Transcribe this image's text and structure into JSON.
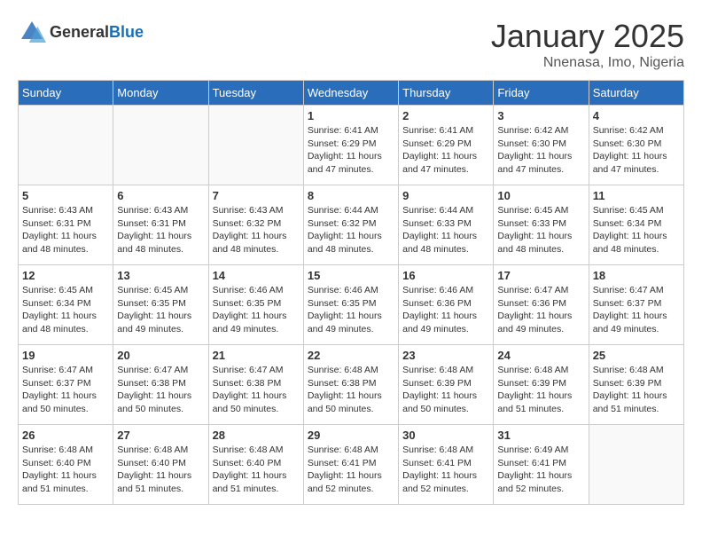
{
  "header": {
    "logo_general": "General",
    "logo_blue": "Blue",
    "month_title": "January 2025",
    "location": "Nnenasa, Imo, Nigeria"
  },
  "days_of_week": [
    "Sunday",
    "Monday",
    "Tuesday",
    "Wednesday",
    "Thursday",
    "Friday",
    "Saturday"
  ],
  "weeks": [
    [
      {
        "day": "",
        "info": ""
      },
      {
        "day": "",
        "info": ""
      },
      {
        "day": "",
        "info": ""
      },
      {
        "day": "1",
        "info": "Sunrise: 6:41 AM\nSunset: 6:29 PM\nDaylight: 11 hours and 47 minutes."
      },
      {
        "day": "2",
        "info": "Sunrise: 6:41 AM\nSunset: 6:29 PM\nDaylight: 11 hours and 47 minutes."
      },
      {
        "day": "3",
        "info": "Sunrise: 6:42 AM\nSunset: 6:30 PM\nDaylight: 11 hours and 47 minutes."
      },
      {
        "day": "4",
        "info": "Sunrise: 6:42 AM\nSunset: 6:30 PM\nDaylight: 11 hours and 47 minutes."
      }
    ],
    [
      {
        "day": "5",
        "info": "Sunrise: 6:43 AM\nSunset: 6:31 PM\nDaylight: 11 hours and 48 minutes."
      },
      {
        "day": "6",
        "info": "Sunrise: 6:43 AM\nSunset: 6:31 PM\nDaylight: 11 hours and 48 minutes."
      },
      {
        "day": "7",
        "info": "Sunrise: 6:43 AM\nSunset: 6:32 PM\nDaylight: 11 hours and 48 minutes."
      },
      {
        "day": "8",
        "info": "Sunrise: 6:44 AM\nSunset: 6:32 PM\nDaylight: 11 hours and 48 minutes."
      },
      {
        "day": "9",
        "info": "Sunrise: 6:44 AM\nSunset: 6:33 PM\nDaylight: 11 hours and 48 minutes."
      },
      {
        "day": "10",
        "info": "Sunrise: 6:45 AM\nSunset: 6:33 PM\nDaylight: 11 hours and 48 minutes."
      },
      {
        "day": "11",
        "info": "Sunrise: 6:45 AM\nSunset: 6:34 PM\nDaylight: 11 hours and 48 minutes."
      }
    ],
    [
      {
        "day": "12",
        "info": "Sunrise: 6:45 AM\nSunset: 6:34 PM\nDaylight: 11 hours and 48 minutes."
      },
      {
        "day": "13",
        "info": "Sunrise: 6:45 AM\nSunset: 6:35 PM\nDaylight: 11 hours and 49 minutes."
      },
      {
        "day": "14",
        "info": "Sunrise: 6:46 AM\nSunset: 6:35 PM\nDaylight: 11 hours and 49 minutes."
      },
      {
        "day": "15",
        "info": "Sunrise: 6:46 AM\nSunset: 6:35 PM\nDaylight: 11 hours and 49 minutes."
      },
      {
        "day": "16",
        "info": "Sunrise: 6:46 AM\nSunset: 6:36 PM\nDaylight: 11 hours and 49 minutes."
      },
      {
        "day": "17",
        "info": "Sunrise: 6:47 AM\nSunset: 6:36 PM\nDaylight: 11 hours and 49 minutes."
      },
      {
        "day": "18",
        "info": "Sunrise: 6:47 AM\nSunset: 6:37 PM\nDaylight: 11 hours and 49 minutes."
      }
    ],
    [
      {
        "day": "19",
        "info": "Sunrise: 6:47 AM\nSunset: 6:37 PM\nDaylight: 11 hours and 50 minutes."
      },
      {
        "day": "20",
        "info": "Sunrise: 6:47 AM\nSunset: 6:38 PM\nDaylight: 11 hours and 50 minutes."
      },
      {
        "day": "21",
        "info": "Sunrise: 6:47 AM\nSunset: 6:38 PM\nDaylight: 11 hours and 50 minutes."
      },
      {
        "day": "22",
        "info": "Sunrise: 6:48 AM\nSunset: 6:38 PM\nDaylight: 11 hours and 50 minutes."
      },
      {
        "day": "23",
        "info": "Sunrise: 6:48 AM\nSunset: 6:39 PM\nDaylight: 11 hours and 50 minutes."
      },
      {
        "day": "24",
        "info": "Sunrise: 6:48 AM\nSunset: 6:39 PM\nDaylight: 11 hours and 51 minutes."
      },
      {
        "day": "25",
        "info": "Sunrise: 6:48 AM\nSunset: 6:39 PM\nDaylight: 11 hours and 51 minutes."
      }
    ],
    [
      {
        "day": "26",
        "info": "Sunrise: 6:48 AM\nSunset: 6:40 PM\nDaylight: 11 hours and 51 minutes."
      },
      {
        "day": "27",
        "info": "Sunrise: 6:48 AM\nSunset: 6:40 PM\nDaylight: 11 hours and 51 minutes."
      },
      {
        "day": "28",
        "info": "Sunrise: 6:48 AM\nSunset: 6:40 PM\nDaylight: 11 hours and 51 minutes."
      },
      {
        "day": "29",
        "info": "Sunrise: 6:48 AM\nSunset: 6:41 PM\nDaylight: 11 hours and 52 minutes."
      },
      {
        "day": "30",
        "info": "Sunrise: 6:48 AM\nSunset: 6:41 PM\nDaylight: 11 hours and 52 minutes."
      },
      {
        "day": "31",
        "info": "Sunrise: 6:49 AM\nSunset: 6:41 PM\nDaylight: 11 hours and 52 minutes."
      },
      {
        "day": "",
        "info": ""
      }
    ]
  ]
}
